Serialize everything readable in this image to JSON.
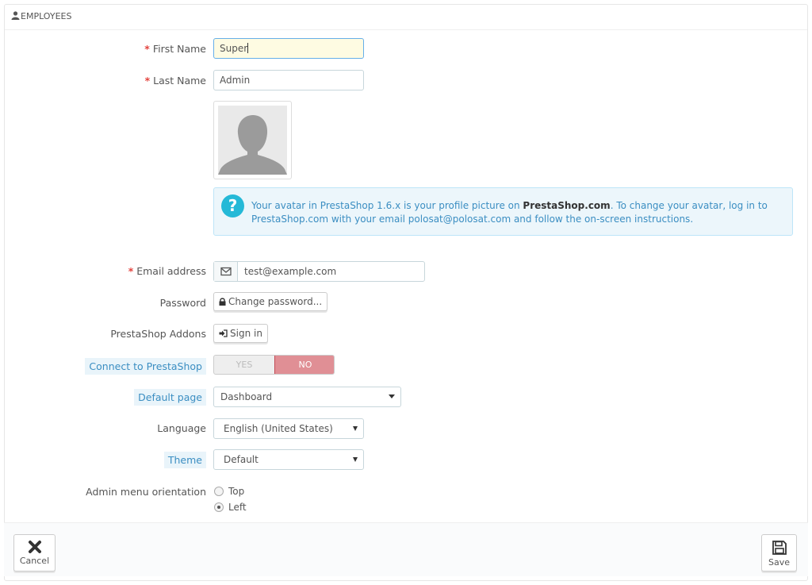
{
  "panel": {
    "title": "EMPLOYEES",
    "icon": "user-icon"
  },
  "form": {
    "first_name": {
      "label": "First Name",
      "required": "*",
      "value": "Super"
    },
    "last_name": {
      "label": "Last Name",
      "required": "*",
      "value": "Admin"
    },
    "avatar": {
      "icon": "avatar-silhouette-icon"
    },
    "avatar_notice": {
      "icon": "question-circle-icon",
      "text_before": "Your avatar in PrestaShop 1.6.x is your profile picture on ",
      "brand": "PrestaShop.com",
      "text_after": ". To change your avatar, log in to PrestaShop.com with your email polosat@polosat.com and follow the on-screen instructions."
    },
    "email": {
      "label": "Email address",
      "required": "*",
      "value": "test@example.com",
      "icon": "envelope-icon"
    },
    "password": {
      "label": "Password",
      "button_label": "Change password...",
      "icon": "lock-icon"
    },
    "addons": {
      "label": "PrestaShop Addons",
      "button_label": "Sign in",
      "icon": "sign-in-icon"
    },
    "connect": {
      "label": "Connect to PrestaShop",
      "yes_label": "YES",
      "no_label": "NO",
      "selected": "NO",
      "active_color": "#e08f95"
    },
    "default_page": {
      "label": "Default page",
      "value": "Dashboard"
    },
    "language": {
      "label": "Language",
      "value": "English (United States)"
    },
    "theme": {
      "label": "Theme",
      "value": "Default"
    },
    "menu_orientation": {
      "label": "Admin menu orientation",
      "options": [
        {
          "label": "Top",
          "checked": false
        },
        {
          "label": "Left",
          "checked": true
        }
      ]
    }
  },
  "footer": {
    "cancel_label": "Cancel",
    "cancel_icon": "close-icon",
    "save_label": "Save",
    "save_icon": "floppy-disk-icon"
  },
  "colors": {
    "required": "#e3433e",
    "hint_text": "#3b8ec2",
    "hint_bg": "#e9f4fa",
    "focused_input_bg": "#fefbe2"
  }
}
